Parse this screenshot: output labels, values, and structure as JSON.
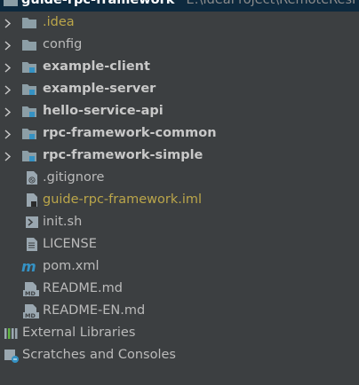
{
  "project_tree": {
    "root": {
      "name": "guide-rpc-framework",
      "path": "E:\\IdeaProject\\RemoteResPro"
    },
    "items": [
      {
        "label": ".idea",
        "kind": "folder",
        "icon": "folder-icon"
      },
      {
        "label": "config",
        "kind": "folder",
        "icon": "folder-icon"
      },
      {
        "label": "example-client",
        "kind": "module",
        "icon": "module-folder-icon"
      },
      {
        "label": "example-server",
        "kind": "module",
        "icon": "module-folder-icon"
      },
      {
        "label": "hello-service-api",
        "kind": "module",
        "icon": "module-folder-icon"
      },
      {
        "label": "rpc-framework-common",
        "kind": "module",
        "icon": "module-folder-icon"
      },
      {
        "label": "rpc-framework-simple",
        "kind": "module",
        "icon": "module-folder-icon"
      },
      {
        "label": ".gitignore",
        "kind": "file",
        "icon": "gitignore-file-icon"
      },
      {
        "label": "guide-rpc-framework.iml",
        "kind": "file",
        "icon": "iml-file-icon"
      },
      {
        "label": "init.sh",
        "kind": "file",
        "icon": "shell-file-icon"
      },
      {
        "label": "LICENSE",
        "kind": "file",
        "icon": "text-file-icon"
      },
      {
        "label": "pom.xml",
        "kind": "file",
        "icon": "maven-file-icon"
      },
      {
        "label": "README.md",
        "kind": "file",
        "icon": "markdown-file-icon"
      },
      {
        "label": "README-EN.md",
        "kind": "file",
        "icon": "markdown-file-icon"
      }
    ],
    "external_libraries": "External Libraries",
    "scratches": "Scratches and Consoles"
  },
  "colors": {
    "background": "#3c3f41",
    "selection": "#0d293e",
    "text": "#bbbbbb",
    "folder": "#8c9ea6",
    "accent_blue": "#3592c4",
    "idea_yellow": "#bba64a"
  }
}
